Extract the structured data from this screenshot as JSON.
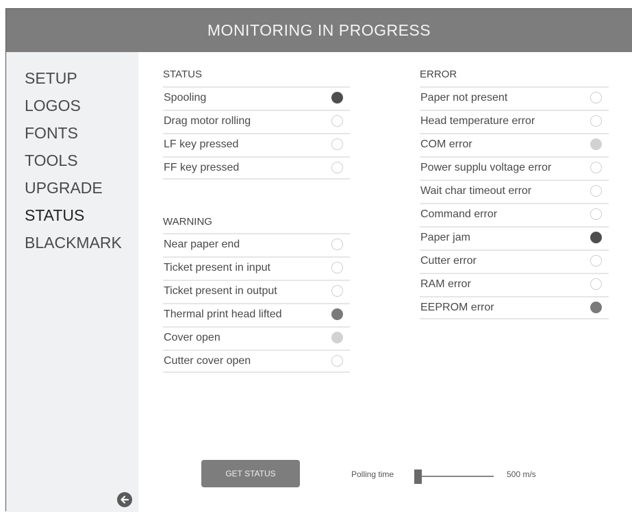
{
  "header": {
    "title": "MONITORING IN PROGRESS"
  },
  "sidebar": {
    "items": [
      {
        "label": "SETUP"
      },
      {
        "label": "LOGOS"
      },
      {
        "label": "FONTS"
      },
      {
        "label": "TOOLS"
      },
      {
        "label": "UPGRADE"
      },
      {
        "label": "STATUS"
      },
      {
        "label": "BLACKMARK"
      }
    ],
    "active": "STATUS",
    "back_icon": "arrow-left-circle-icon"
  },
  "status": {
    "title": "STATUS",
    "items": [
      {
        "label": "Spooling",
        "state": "on-dark"
      },
      {
        "label": "Drag motor rolling",
        "state": "off"
      },
      {
        "label": "LF key pressed",
        "state": "off"
      },
      {
        "label": "FF key pressed",
        "state": "off"
      }
    ]
  },
  "warning": {
    "title": "WARNING",
    "items": [
      {
        "label": "Near paper end",
        "state": "off"
      },
      {
        "label": "Ticket present in input",
        "state": "off"
      },
      {
        "label": "Ticket present in output",
        "state": "off"
      },
      {
        "label": "Thermal print head lifted",
        "state": "on-mid"
      },
      {
        "label": "Cover open",
        "state": "on-light"
      },
      {
        "label": "Cutter cover open",
        "state": "off"
      }
    ]
  },
  "error": {
    "title": "ERROR",
    "items": [
      {
        "label": "Paper not present",
        "state": "off"
      },
      {
        "label": "Head temperature error",
        "state": "off"
      },
      {
        "label": "COM error",
        "state": "on-light"
      },
      {
        "label": "Power supplu voltage error",
        "state": "off"
      },
      {
        "label": "Wait char timeout error",
        "state": "off"
      },
      {
        "label": "Command error",
        "state": "off"
      },
      {
        "label": "Paper jam",
        "state": "on-dark"
      },
      {
        "label": "Cutter error",
        "state": "off"
      },
      {
        "label": "RAM error",
        "state": "off"
      },
      {
        "label": "EEPROM error",
        "state": "on-mid"
      }
    ]
  },
  "controls": {
    "get_status_label": "GET STATUS",
    "polling_label": "Polling time",
    "polling_value": "500 m/s",
    "polling_slider_level": 0
  },
  "colors": {
    "header_bg": "#7d7d7d",
    "sidebar_bg": "#f0f1f3",
    "indicator_dark": "#4e4e4e",
    "indicator_mid": "#7a7a7a",
    "indicator_light": "#d2d2d2"
  }
}
